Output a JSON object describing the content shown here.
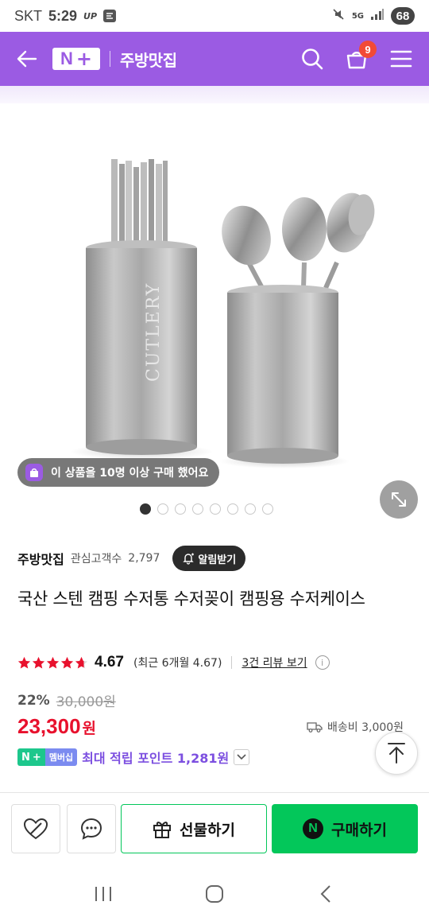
{
  "status_bar": {
    "carrier": "SKT",
    "time": "5:29",
    "mini_label": "UP",
    "network": "5G",
    "battery": "68"
  },
  "header": {
    "logo": "N+",
    "store_name": "주방맛집",
    "cart_count": "9",
    "brand_color": "#9b5be3"
  },
  "gallery": {
    "purchase_badge": "이 상품을 10명 이상 구매 했어요",
    "engraving": "CUTLERY",
    "total_images": 8,
    "active_index": 0
  },
  "product": {
    "store": "주방맛집",
    "fans_label": "관심고객수",
    "fans_count": "2,797",
    "alarm_label": "알림받기",
    "title": "국산 스텐 캠핑 수저통 수저꽂이 캠핑용 수저케이스",
    "rating": "4.67",
    "rating_recent": "(최근 6개월 4.67)",
    "review_link": "3건 리뷰 보기",
    "discount": "22%",
    "original_price": "30,000원",
    "price": "23,300",
    "price_unit": "원",
    "shipping": "배송비 3,000원",
    "membership_badge": "멤버십",
    "points": "최대 적립 포인트 1,281원",
    "accent_price": "#e8112d",
    "accent_points": "#7c4fe0"
  },
  "actions": {
    "gift": "선물하기",
    "buy": "구매하기",
    "buy_color": "#03c75a"
  }
}
